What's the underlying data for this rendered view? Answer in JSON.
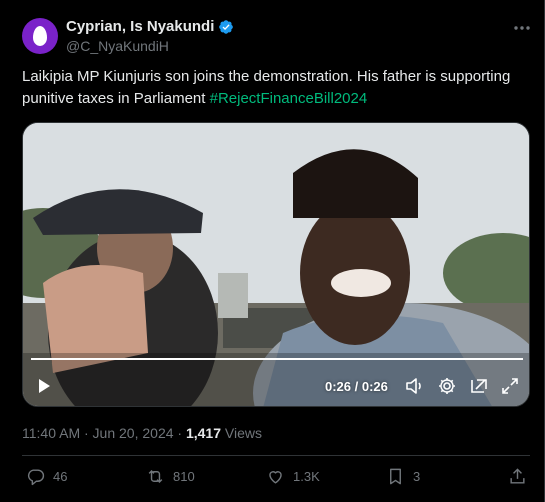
{
  "author": {
    "display_name": "Cyprian, Is Nyakundi",
    "handle": "@C_NyaKundiH"
  },
  "tweet": {
    "text": "Laikipia MP Kiunjuris son joins the demonstration. His father is supporting punitive taxes in Parliament ",
    "hashtag": "#RejectFinanceBill2024"
  },
  "video": {
    "time_display": "0:26 / 0:26",
    "progress": 1.0
  },
  "meta": {
    "timestamp": "11:40 AM · Jun 20, 2024 · ",
    "views_count": "1,417",
    "views_label": " Views"
  },
  "actions": {
    "replies": "46",
    "reposts": "810",
    "likes": "1.3K",
    "bookmarks": "3"
  },
  "colors": {
    "verified": "#1d9bf0",
    "hashtag": "#00ba7c",
    "avatar_bg": "#7a22c9"
  },
  "icons": [
    "verified-badge-icon",
    "more-icon",
    "play-icon",
    "volume-icon",
    "settings-icon",
    "popout-icon",
    "fullscreen-icon",
    "reply-icon",
    "repost-icon",
    "like-icon",
    "bookmark-icon",
    "share-icon"
  ]
}
